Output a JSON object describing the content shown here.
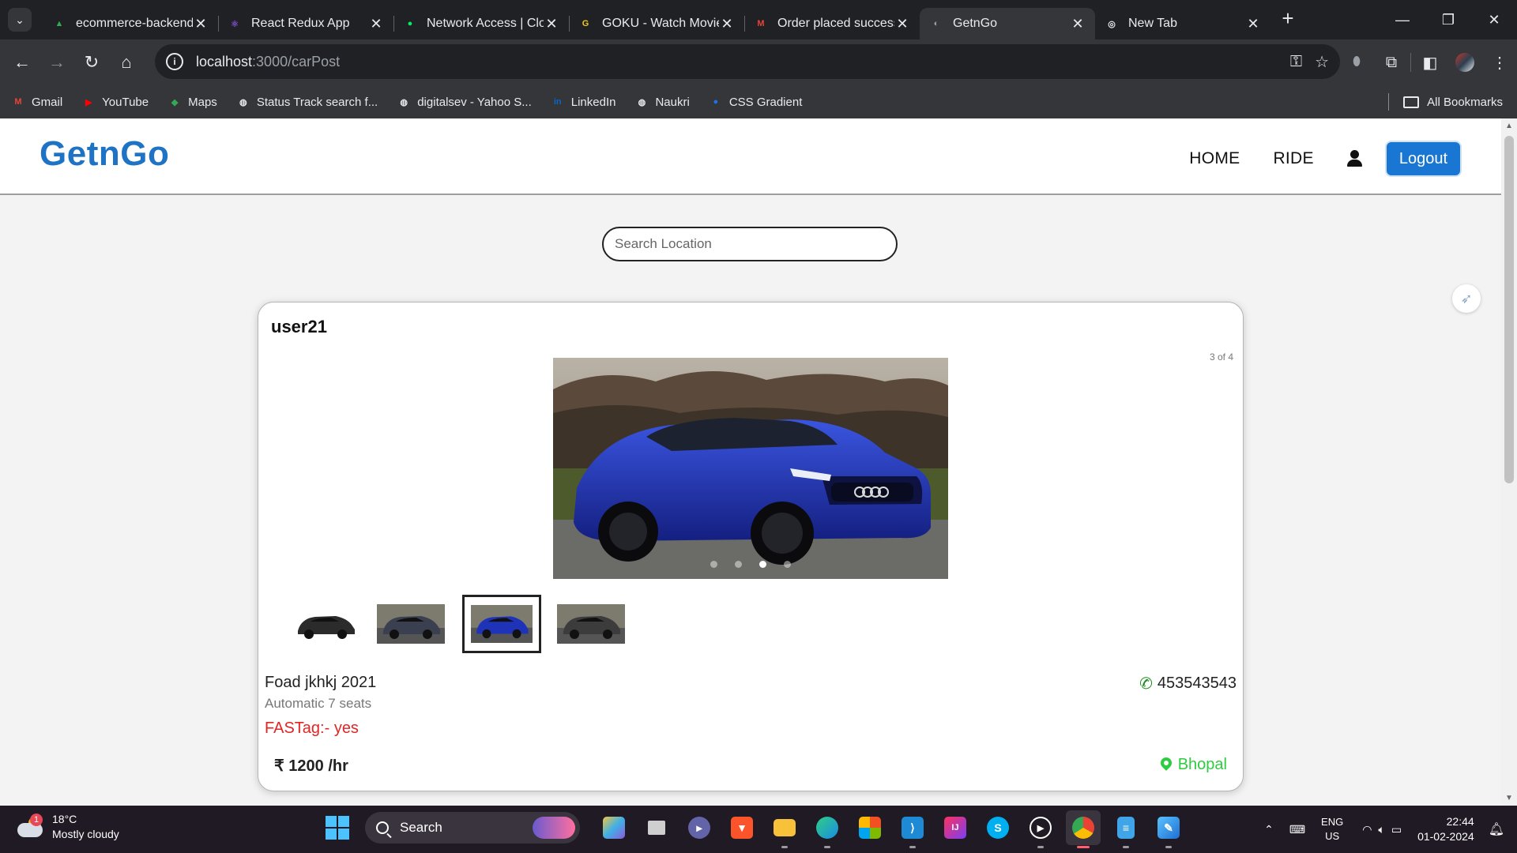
{
  "browser": {
    "tabs": [
      {
        "title": "ecommerce-backend",
        "icon": "drive-icon",
        "color": "#34a853",
        "glyph": "▲",
        "active": false
      },
      {
        "title": "React Redux App",
        "icon": "redux-icon",
        "color": "#764abc",
        "glyph": "⚛",
        "active": false
      },
      {
        "title": "Network Access | Clo",
        "icon": "mongodb-icon",
        "color": "#00ed64",
        "glyph": "●",
        "active": false
      },
      {
        "title": "GOKU - Watch Movie",
        "icon": "goku-icon",
        "color": "#f5c518",
        "glyph": "G",
        "active": false
      },
      {
        "title": "Order placed success",
        "icon": "gmail-icon",
        "color": "#ea4335",
        "glyph": "M",
        "active": false
      },
      {
        "title": "GetnGo",
        "icon": "getngo-icon",
        "color": "#9aa0a6",
        "glyph": "◐",
        "active": true
      },
      {
        "title": "New Tab",
        "icon": "chrome-icon",
        "color": "#e8eaed",
        "glyph": "◎",
        "active": false
      }
    ],
    "url_host": "localhost",
    "url_path": ":3000/carPost",
    "bookmarks": [
      {
        "label": "Gmail",
        "icon": "gmail-icon",
        "color": "#ea4335",
        "glyph": "M"
      },
      {
        "label": "YouTube",
        "icon": "youtube-icon",
        "color": "#ff0000",
        "glyph": "▶"
      },
      {
        "label": "Maps",
        "icon": "maps-icon",
        "color": "#34a853",
        "glyph": "◆"
      },
      {
        "label": "Status Track search f...",
        "icon": "globe-icon",
        "color": "#e8eaed",
        "glyph": "◍"
      },
      {
        "label": "digitalsev - Yahoo S...",
        "icon": "globe-icon",
        "color": "#e8eaed",
        "glyph": "◍"
      },
      {
        "label": "LinkedIn",
        "icon": "linkedin-icon",
        "color": "#0a66c2",
        "glyph": "in"
      },
      {
        "label": "Naukri",
        "icon": "globe-icon",
        "color": "#e8eaed",
        "glyph": "◍"
      },
      {
        "label": "CSS Gradient",
        "icon": "cssgradient-icon",
        "color": "#1a73e8",
        "glyph": "●"
      }
    ],
    "all_bookmarks": "All Bookmarks"
  },
  "page": {
    "brand": "GetnGo",
    "nav": {
      "home": "HOME",
      "ride": "RIDE",
      "logout": "Logout"
    },
    "search_placeholder": "Search Location"
  },
  "post": {
    "user": "user21",
    "counter": "3 of 4",
    "image_count": 4,
    "selected_index": 2,
    "car_name": "Foad jkhkj 2021",
    "spec": "Automatic 7 seats",
    "fastag": "FASTag:- yes",
    "price": "₹ 1200 /hr",
    "phone": "453543543",
    "location": "Bhopal",
    "thumbnails": [
      {
        "name": "thumbnail-black-suv",
        "color": "#2b2b2b"
      },
      {
        "name": "thumbnail-grey-suv",
        "color": "#3a4050"
      },
      {
        "name": "thumbnail-blue-audi",
        "color": "#1f33b8"
      },
      {
        "name": "thumbnail-dark-pickup",
        "color": "#3c3c3c"
      }
    ]
  },
  "taskbar": {
    "temp": "18°C",
    "weather": "Mostly cloudy",
    "weather_badge": "1",
    "search": "Search",
    "lang": "ENG",
    "region": "US",
    "time": "22:44",
    "date": "01-02-2024"
  }
}
